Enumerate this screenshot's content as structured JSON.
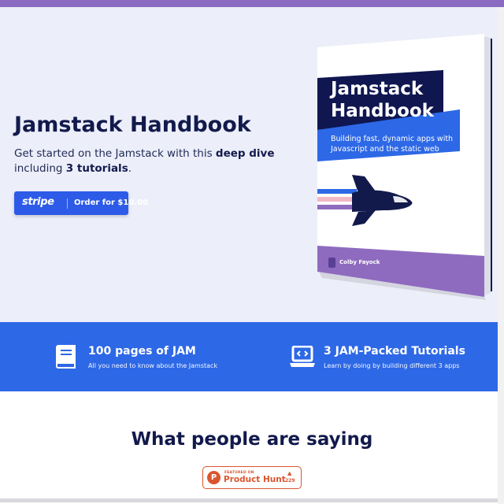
{
  "hero": {
    "title": "Jamstack Handbook",
    "desc_pre": "Get started on the Jamstack with this ",
    "desc_bold1": "deep dive",
    "desc_mid": " including ",
    "desc_bold2": "3 tutorials",
    "desc_end": "."
  },
  "order_button": {
    "brand": "stripe",
    "label": "Order for $10.00"
  },
  "book": {
    "title_line1": "Jamstack",
    "title_line2": "Handbook",
    "subtitle": "Building fast, dynamic apps with Javascript and the static web",
    "author": "Colby Fayock"
  },
  "features": [
    {
      "icon": "book-icon",
      "title": "100 pages of JAM",
      "desc": "All you need to know about the Jamstack"
    },
    {
      "icon": "laptop-code-icon",
      "title": "3 JAM-Packed Tutorials",
      "desc": "Learn by doing by building different 3 apps"
    }
  ],
  "testimonials": {
    "heading": "What people are saying"
  },
  "product_hunt": {
    "featured": "FEATURED ON",
    "name": "Product Hunt",
    "logo_letter": "P",
    "count": "229"
  },
  "colors": {
    "top_bar": "#8a6bc1",
    "hero_bg": "#eceef9",
    "navy": "#121a4c",
    "blue": "#2d68e6",
    "purple": "#8e6bbf",
    "product_hunt": "#da552f"
  }
}
